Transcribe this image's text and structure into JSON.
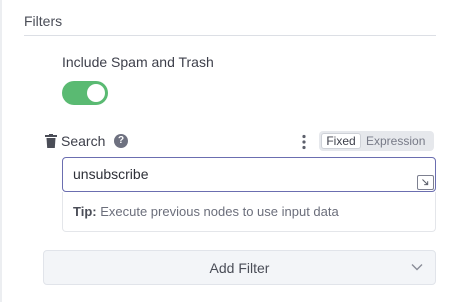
{
  "filters": {
    "title": "Filters",
    "include_spam_trash": {
      "label": "Include Spam and Trash",
      "enabled": true
    },
    "search": {
      "label": "Search",
      "mode_options": [
        "Fixed",
        "Expression"
      ],
      "selected_mode": "Fixed",
      "value": "unsubscribe",
      "tip_key": "Tip:",
      "tip_text": "Execute previous nodes to use input data"
    },
    "add_filter_label": "Add Filter"
  },
  "colors": {
    "toggle_on": "#5aba72",
    "input_focus_border": "#6b6eb0"
  },
  "icons": {
    "delete": "trash-icon",
    "help": "question-circle-icon",
    "options": "kebab-menu-icon",
    "expand": "expand-icon",
    "dropdown": "chevron-down-icon"
  }
}
